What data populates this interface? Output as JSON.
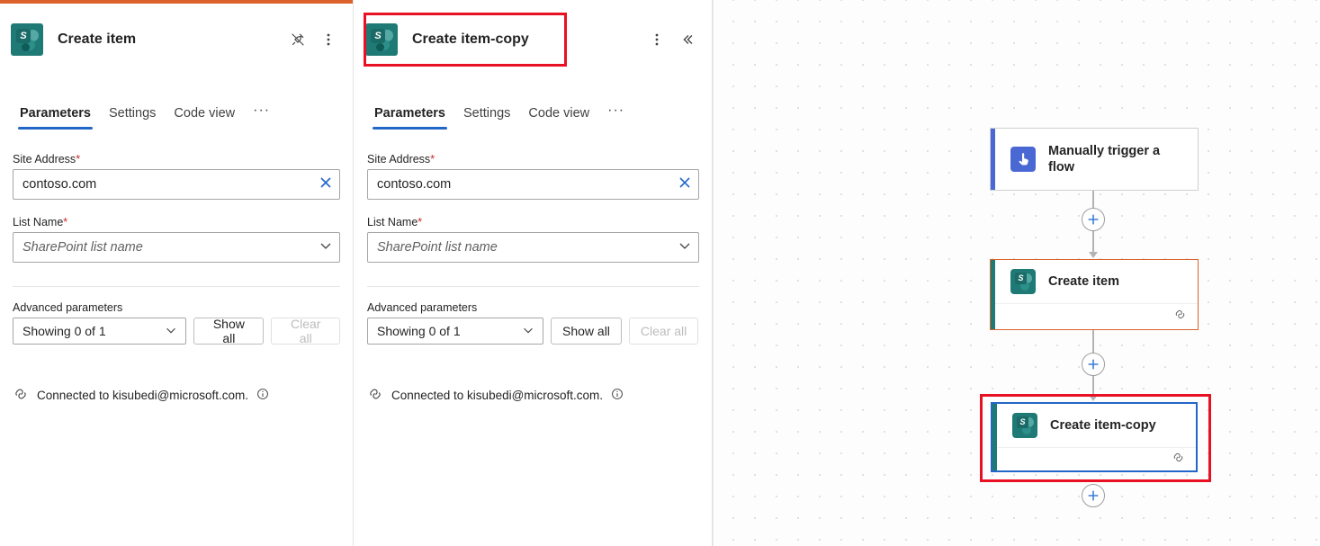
{
  "theme": {
    "accent_orange": "#d9632b",
    "accent_blue": "#2266c8",
    "sharepoint_teal": "#1f7a76",
    "trigger_blue": "#4a68d4",
    "highlight_red": "#e81123",
    "required_red": "#c62828"
  },
  "panels": [
    {
      "id": "create-item",
      "title": "Create item",
      "icon": "sharepoint-icon",
      "header_actions": [
        "unpin-icon",
        "more-options-icon"
      ],
      "tabs": [
        {
          "label": "Parameters",
          "active": true
        },
        {
          "label": "Settings",
          "active": false
        },
        {
          "label": "Code view",
          "active": false
        }
      ],
      "tab_overflow": "···",
      "fields": [
        {
          "label": "Site Address",
          "required_marker": "*",
          "value": "contoso.com",
          "placeholder": "",
          "trailing_icon": "clear-icon"
        },
        {
          "label": "List Name",
          "required_marker": "*",
          "value": "",
          "placeholder": "SharePoint list name",
          "trailing_icon": "chevron-down-icon"
        }
      ],
      "advanced": {
        "label": "Advanced parameters",
        "select_value": "Showing 0 of 1",
        "show_all_label": "Show all",
        "clear_all_label": "Clear all",
        "clear_all_disabled": true
      },
      "connection": {
        "icon": "link-icon",
        "text": "Connected to kisubedi@microsoft.com.",
        "info_icon": "info-icon"
      }
    },
    {
      "id": "create-item-copy",
      "title": "Create item-copy",
      "icon": "sharepoint-icon",
      "header_actions": [
        "more-options-icon",
        "collapse-icon"
      ],
      "tabs": [
        {
          "label": "Parameters",
          "active": true
        },
        {
          "label": "Settings",
          "active": false
        },
        {
          "label": "Code view",
          "active": false
        }
      ],
      "tab_overflow": "···",
      "fields": [
        {
          "label": "Site Address",
          "required_marker": "*",
          "value": "contoso.com",
          "placeholder": "",
          "trailing_icon": "clear-icon"
        },
        {
          "label": "List Name",
          "required_marker": "*",
          "value": "",
          "placeholder": "SharePoint list name",
          "trailing_icon": "chevron-down-icon"
        }
      ],
      "advanced": {
        "label": "Advanced parameters",
        "select_value": "Showing 0 of 1",
        "show_all_label": "Show all",
        "clear_all_label": "Clear all",
        "clear_all_disabled": true
      },
      "connection": {
        "icon": "link-icon",
        "text": "Connected to kisubedi@microsoft.com.",
        "info_icon": "info-icon"
      }
    }
  ],
  "canvas": {
    "nodes": [
      {
        "id": "trigger",
        "label": "Manually trigger a flow",
        "icon": "manual-trigger-icon",
        "accent_color": "#4a68d4",
        "border_color": "#d0d0d0",
        "has_footer": false,
        "selected": false
      },
      {
        "id": "create-item",
        "label": "Create item",
        "icon": "sharepoint-icon",
        "accent_color": "#1f7a76",
        "border_color": "#d9632b",
        "has_footer": true,
        "footer_icon": "link-icon",
        "selected": false
      },
      {
        "id": "create-item-copy",
        "label": "Create item-copy",
        "icon": "sharepoint-icon",
        "accent_color": "#1f7a76",
        "border_color": "#2266c8",
        "has_footer": true,
        "footer_icon": "link-icon",
        "selected": true
      }
    ],
    "add_buttons": [
      "add-step-1",
      "add-step-2",
      "add-step-3"
    ],
    "add_button_glyph": "+"
  },
  "annotations": [
    {
      "id": "highlight-panel-header",
      "target": "create-item-copy-panel-header"
    },
    {
      "id": "highlight-canvas-node",
      "target": "create-item-copy-node"
    }
  ]
}
